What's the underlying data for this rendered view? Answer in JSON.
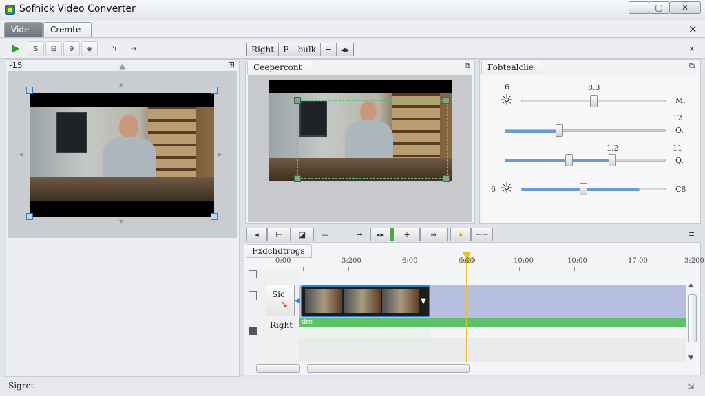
{
  "window": {
    "title": "Sofhick Video Converter",
    "buttons": {
      "minimize": "–",
      "maximize": "▢",
      "close": "✕"
    }
  },
  "tabs": [
    {
      "label": "Vide",
      "active": true
    },
    {
      "label": "Cremte",
      "active": false
    }
  ],
  "tabbar_close": "×",
  "toolbar": {
    "play_icon": "play-icon",
    "btn2_label": "S",
    "btn3_label": "⊟",
    "btn4_label": "9",
    "btn5_label": "◈",
    "btn6_label": "↰",
    "btn7_label": "⇢",
    "segment": [
      "Right",
      "F",
      "bulk",
      "⊢",
      "◂▸"
    ],
    "overflow": "×"
  },
  "source_pane": {
    "header_value": "-15",
    "menu_glyph": "⊞"
  },
  "preview_pane": {
    "tab_label": "Ceepercont",
    "pin_glyph": "⧉"
  },
  "adjust_pane": {
    "tab_label": "Fobtealclie",
    "pin_glyph": "⧉",
    "sliders": [
      {
        "name": "brightness",
        "left_label": "6",
        "value_label": "8.3",
        "right_label": "M.",
        "value": 0.5,
        "icon": "sun-icon"
      },
      {
        "name": "contrast",
        "left_label": "",
        "value_label": "",
        "top_right_label": "12",
        "right_label": "O.",
        "value": 0.32
      },
      {
        "name": "range",
        "left_label": "",
        "value_label": "1.2",
        "top_right_label": "11",
        "right_label": "Q.",
        "value_low": 0.38,
        "value_high": 0.65
      },
      {
        "name": "saturation",
        "left_label": "6",
        "right_label": "C8",
        "value": 0.48,
        "icon": "sun-icon"
      }
    ]
  },
  "transport": {
    "buttons": [
      "◂",
      "⊢",
      "◪",
      "—",
      "→",
      "▸▸",
      "+",
      "⇛",
      "★",
      "⊣⊢"
    ],
    "overflow": "≡"
  },
  "timeline": {
    "tab_label": "Fxdchdtrogs",
    "ruler_labels": [
      "0:00",
      "3:200",
      "6:00",
      "0:00",
      "10:00",
      "10:00",
      "17:00",
      "3:200"
    ],
    "playhead_label": "0:00",
    "track_label_top": "Sic",
    "track_label_bottom": "Right",
    "audio_label": "dm",
    "scroll_up": "▲",
    "scroll_down": "▼"
  },
  "statusbar": {
    "text": "Sigret",
    "grip": "⇲"
  },
  "colors": {
    "accent_blue": "#6b9bd6",
    "timeline_green": "#5cc16a",
    "playhead_yellow": "#e8c02e",
    "timeline_track": "#b7bfe0"
  }
}
